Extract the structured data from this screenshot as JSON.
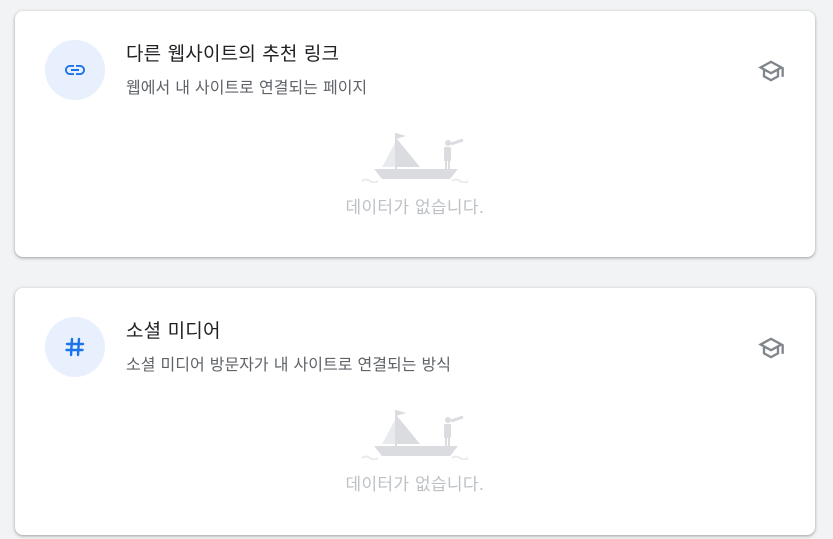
{
  "cards": [
    {
      "title": "다른 웹사이트의 추천 링크",
      "subtitle": "웹에서 내 사이트로 연결되는 페이지",
      "icon": "link-icon",
      "learn_icon": "school-icon",
      "empty_text": "데이터가 없습니다."
    },
    {
      "title": "소셜 미디어",
      "subtitle": "소셜 미디어 방문자가 내 사이트로 연결되는 방식",
      "icon": "hashtag-icon",
      "learn_icon": "school-icon",
      "empty_text": "데이터가 없습니다."
    }
  ],
  "colors": {
    "accent": "#1a73e8",
    "icon_bg": "#e8f0fe",
    "learn_icon": "#80868b",
    "illustration": "#dadce0",
    "empty_text": "#bdc1c6"
  }
}
